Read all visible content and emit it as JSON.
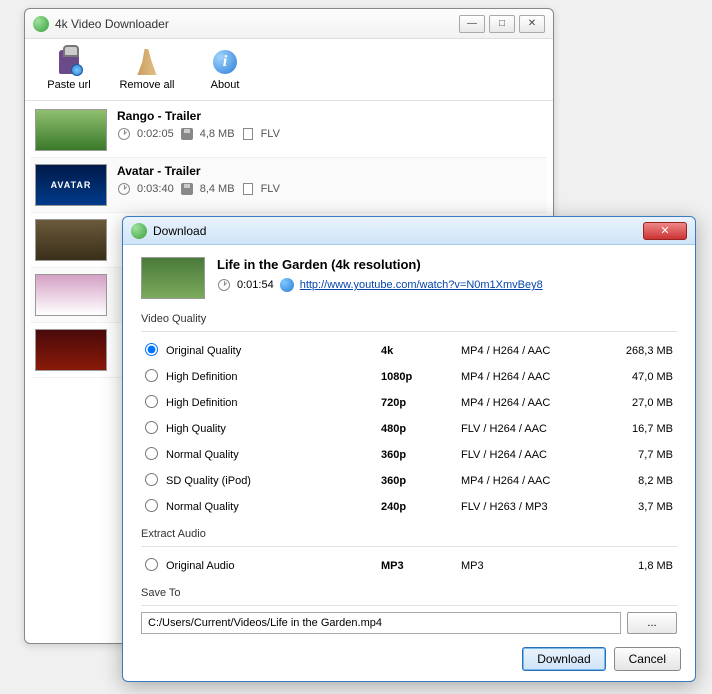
{
  "main": {
    "title": "4k Video Downloader",
    "toolbar": {
      "paste": "Paste url",
      "remove": "Remove all",
      "about": "About"
    },
    "videos": [
      {
        "title": "Rango - Trailer",
        "duration": "0:02:05",
        "size": "4,8 MB",
        "format": "FLV",
        "thumbClass": "green"
      },
      {
        "title": "Avatar - Trailer",
        "duration": "0:03:40",
        "size": "8,4 MB",
        "format": "FLV",
        "thumbClass": "avatar",
        "thumbText": "AVATAR"
      }
    ],
    "hiddenThumbs": [
      "sack",
      "dance",
      "red"
    ]
  },
  "dialog": {
    "title": "Download",
    "video_title": "Life in the Garden (4k resolution)",
    "duration": "0:01:54",
    "url": "http://www.youtube.com/watch?v=N0m1XmvBey8",
    "sections": {
      "quality": "Video Quality",
      "audio": "Extract Audio",
      "save": "Save To"
    },
    "quality_options": [
      {
        "label": "Original Quality",
        "res": "4k",
        "fmt": "MP4 / H264 / AAC",
        "size": "268,3 MB",
        "checked": true
      },
      {
        "label": "High Definition",
        "res": "1080p",
        "fmt": "MP4 / H264 / AAC",
        "size": "47,0 MB"
      },
      {
        "label": "High Definition",
        "res": "720p",
        "fmt": "MP4 / H264 / AAC",
        "size": "27,0 MB"
      },
      {
        "label": "High Quality",
        "res": "480p",
        "fmt": "FLV / H264 / AAC",
        "size": "16,7 MB"
      },
      {
        "label": "Normal Quality",
        "res": "360p",
        "fmt": "FLV / H264 / AAC",
        "size": "7,7 MB"
      },
      {
        "label": "SD Quality (iPod)",
        "res": "360p",
        "fmt": "MP4 / H264 / AAC",
        "size": "8,2 MB"
      },
      {
        "label": "Normal Quality",
        "res": "240p",
        "fmt": "FLV / H263 / MP3",
        "size": "3,7 MB"
      }
    ],
    "audio_options": [
      {
        "label": "Original Audio",
        "res": "MP3",
        "fmt": "MP3",
        "size": "1,8 MB"
      }
    ],
    "save_path": "C:/Users/Current/Videos/Life in the Garden.mp4",
    "browse_label": "...",
    "buttons": {
      "download": "Download",
      "cancel": "Cancel"
    }
  }
}
